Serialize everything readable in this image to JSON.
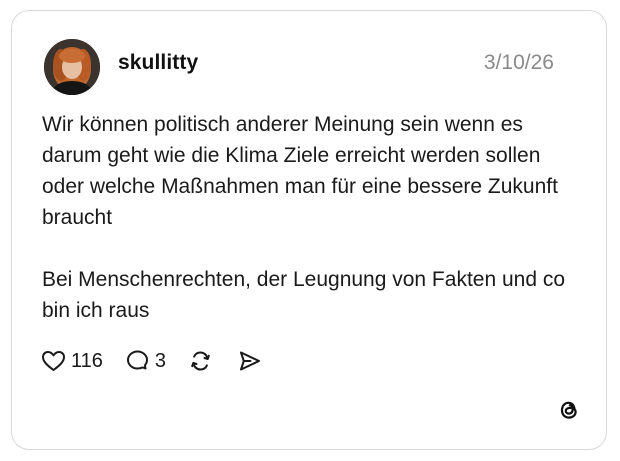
{
  "post": {
    "username": "skullitty",
    "date": "3/10/26",
    "paragraphs": [
      "Wir können politisch anderer Meinung sein wenn es darum geht wie die Klima Ziele erreicht werden sollen oder welche Maßnahmen man für eine bessere Zukunft braucht",
      "Bei Menschenrechten, der Leugnung von Fakten und co bin ich raus"
    ],
    "likes": "116",
    "replies": "3"
  },
  "icons": {
    "like": "heart-icon",
    "reply": "speech-bubble-icon",
    "repost": "repost-icon",
    "share": "send-icon",
    "brand": "threads-logo-icon"
  },
  "colors": {
    "text": "#1a1a1a",
    "muted": "#8a8a8a",
    "border": "#d9d9d9",
    "background": "#ffffff"
  }
}
